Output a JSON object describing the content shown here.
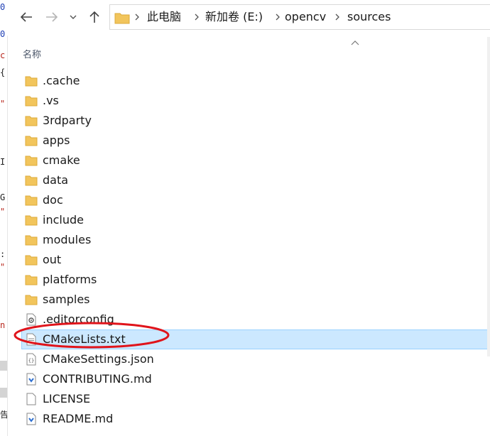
{
  "left_fragments": [
    {
      "text": "0",
      "color": "blue"
    },
    {
      "text": "0",
      "color": "blue"
    },
    {
      "text": "c",
      "color": "red"
    },
    {
      "text": "{",
      "color": "dark"
    },
    {
      "text": "\"",
      "color": "red"
    },
    {
      "text": "I",
      "color": "dark"
    },
    {
      "text": "G",
      "color": "dark"
    },
    {
      "text": "\"",
      "color": "red"
    },
    {
      "text": ":",
      "color": "dark"
    },
    {
      "text": "\"",
      "color": "red"
    },
    {
      "text": "n",
      "color": "red"
    },
    {
      "text": "告",
      "color": "dark"
    }
  ],
  "nav": {
    "back_icon": "back-arrow-icon",
    "forward_icon": "forward-arrow-icon",
    "recent_icon": "chevron-down-icon",
    "up_icon": "up-arrow-icon"
  },
  "address": {
    "crumbs": [
      "此电脑",
      "新加卷 (E:)",
      "opencv",
      "sources"
    ]
  },
  "header": {
    "name_column": "名称"
  },
  "files": [
    {
      "name": ".cache",
      "type": "folder"
    },
    {
      "name": ".vs",
      "type": "folder"
    },
    {
      "name": "3rdparty",
      "type": "folder"
    },
    {
      "name": "apps",
      "type": "folder"
    },
    {
      "name": "cmake",
      "type": "folder"
    },
    {
      "name": "data",
      "type": "folder"
    },
    {
      "name": "doc",
      "type": "folder"
    },
    {
      "name": "include",
      "type": "folder"
    },
    {
      "name": "modules",
      "type": "folder"
    },
    {
      "name": "out",
      "type": "folder"
    },
    {
      "name": "platforms",
      "type": "folder"
    },
    {
      "name": "samples",
      "type": "folder"
    },
    {
      "name": ".editorconfig",
      "type": "config"
    },
    {
      "name": "CMakeLists.txt",
      "type": "text",
      "selected": true
    },
    {
      "name": "CMakeSettings.json",
      "type": "json"
    },
    {
      "name": "CONTRIBUTING.md",
      "type": "markdown"
    },
    {
      "name": "LICENSE",
      "type": "blank"
    },
    {
      "name": "README.md",
      "type": "markdown"
    }
  ],
  "colors": {
    "folder": "#f2c55c",
    "folder_dark": "#dcaa3a",
    "selection_bg": "#cce8ff",
    "selection_border": "#99d1ff",
    "annotation": "#e0141b",
    "markdown_badge": "#2d6fd1"
  }
}
